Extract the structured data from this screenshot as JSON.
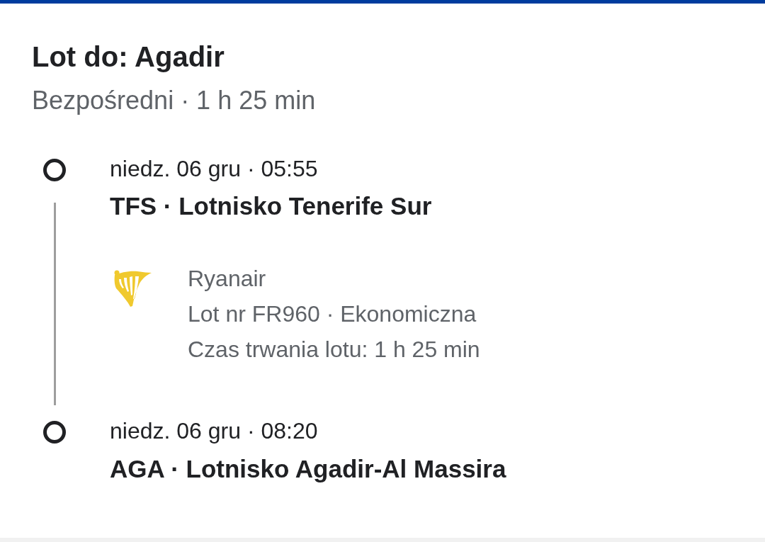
{
  "header": {
    "title": "Lot do: Agadir",
    "subtitle": "Bezpośredni · 1 h 25 min"
  },
  "itinerary": [
    {
      "kind": "stop",
      "datetime": "niedz. 06 gru · 05:55",
      "airport": "TFS · Lotnisko Tenerife Sur"
    },
    {
      "kind": "segment",
      "airline": "Ryanair",
      "details": [
        "Lot nr FR960 · Ekonomiczna",
        "Czas trwania lotu: 1 h 25 min"
      ]
    },
    {
      "kind": "stop",
      "datetime": "niedz. 06 gru · 08:20",
      "airport": "AGA · Lotnisko Agadir-Al Massira"
    }
  ]
}
